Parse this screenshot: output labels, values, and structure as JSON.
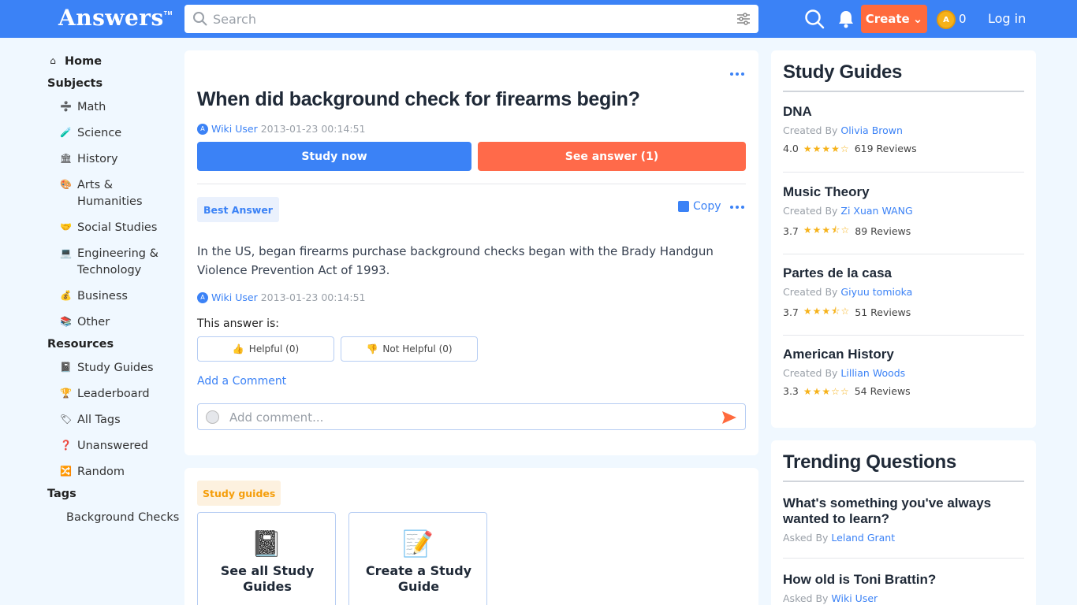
{
  "header": {
    "logo": "Answers",
    "logo_tm": "TM",
    "search_placeholder": "Search",
    "create_label": "Create",
    "coin_count": "0",
    "login_label": "Log in"
  },
  "sidebar": {
    "home": "Home",
    "subjects_heading": "Subjects",
    "subjects": [
      {
        "label": "Math",
        "icon": "➗"
      },
      {
        "label": "Science",
        "icon": "🧪"
      },
      {
        "label": "History",
        "icon": "🏛"
      },
      {
        "label": "Arts & Humanities",
        "icon": "🎨"
      },
      {
        "label": "Social Studies",
        "icon": "🤝"
      },
      {
        "label": "Engineering & Technology",
        "icon": "💻"
      },
      {
        "label": "Business",
        "icon": "💰"
      },
      {
        "label": "Other",
        "icon": "📚"
      }
    ],
    "resources_heading": "Resources",
    "resources": [
      {
        "label": "Study Guides",
        "icon": "📓"
      },
      {
        "label": "Leaderboard",
        "icon": "🏆"
      },
      {
        "label": "All Tags",
        "icon": "🏷"
      },
      {
        "label": "Unanswered",
        "icon": "❓"
      },
      {
        "label": "Random",
        "icon": "🔀"
      }
    ],
    "tags_heading": "Tags",
    "tags": [
      "Background Checks"
    ]
  },
  "question": {
    "title": "When did background check for firearms begin?",
    "user": "Wiki User",
    "time": "2013-01-23 00:14:51",
    "study_now": "Study now",
    "see_answer": "See answer (1)"
  },
  "answer": {
    "badge": "Best Answer",
    "copy_label": "Copy",
    "text": "In the US, began firearms purchase background checks began with the Brady Handgun Violence Prevention Act of 1993.",
    "user": "Wiki User",
    "time": "2013-01-23 00:14:51",
    "this_answer_is": "This answer is:",
    "helpful": "Helpful (0)",
    "not_helpful": "Not Helpful (0)",
    "add_comment": "Add a Comment",
    "comment_placeholder": "Add comment..."
  },
  "study_guides_section": {
    "badge": "Study guides",
    "see_all": "See all Study Guides",
    "create": "Create a Study Guide"
  },
  "rail": {
    "guides_title": "Study Guides",
    "created_by": "Created By",
    "guides": [
      {
        "name": "DNA",
        "author": "Olivia Brown",
        "rating": "4.0",
        "stars": "★★★★☆",
        "reviews": "619 Reviews"
      },
      {
        "name": "Music Theory",
        "author": "Zi Xuan WANG",
        "rating": "3.7",
        "stars": "★★★⯪☆",
        "reviews": "89 Reviews"
      },
      {
        "name": "Partes de la casa",
        "author": "Giyuu tomioka",
        "rating": "3.7",
        "stars": "★★★⯪☆",
        "reviews": "51 Reviews"
      },
      {
        "name": "American History",
        "author": "Lillian Woods",
        "rating": "3.3",
        "stars": "★★★☆☆",
        "reviews": "54 Reviews"
      }
    ],
    "trending_title": "Trending Questions",
    "asked_by": "Asked By",
    "trending": [
      {
        "q": "What's something you've always wanted to learn?",
        "author": "Leland Grant"
      },
      {
        "q": "How old is Toni Brattin?",
        "author": "Wiki User"
      }
    ]
  },
  "colors": {
    "primary": "#3b82f6",
    "accent": "#ff6a4a",
    "background": "#f0f8ff"
  }
}
